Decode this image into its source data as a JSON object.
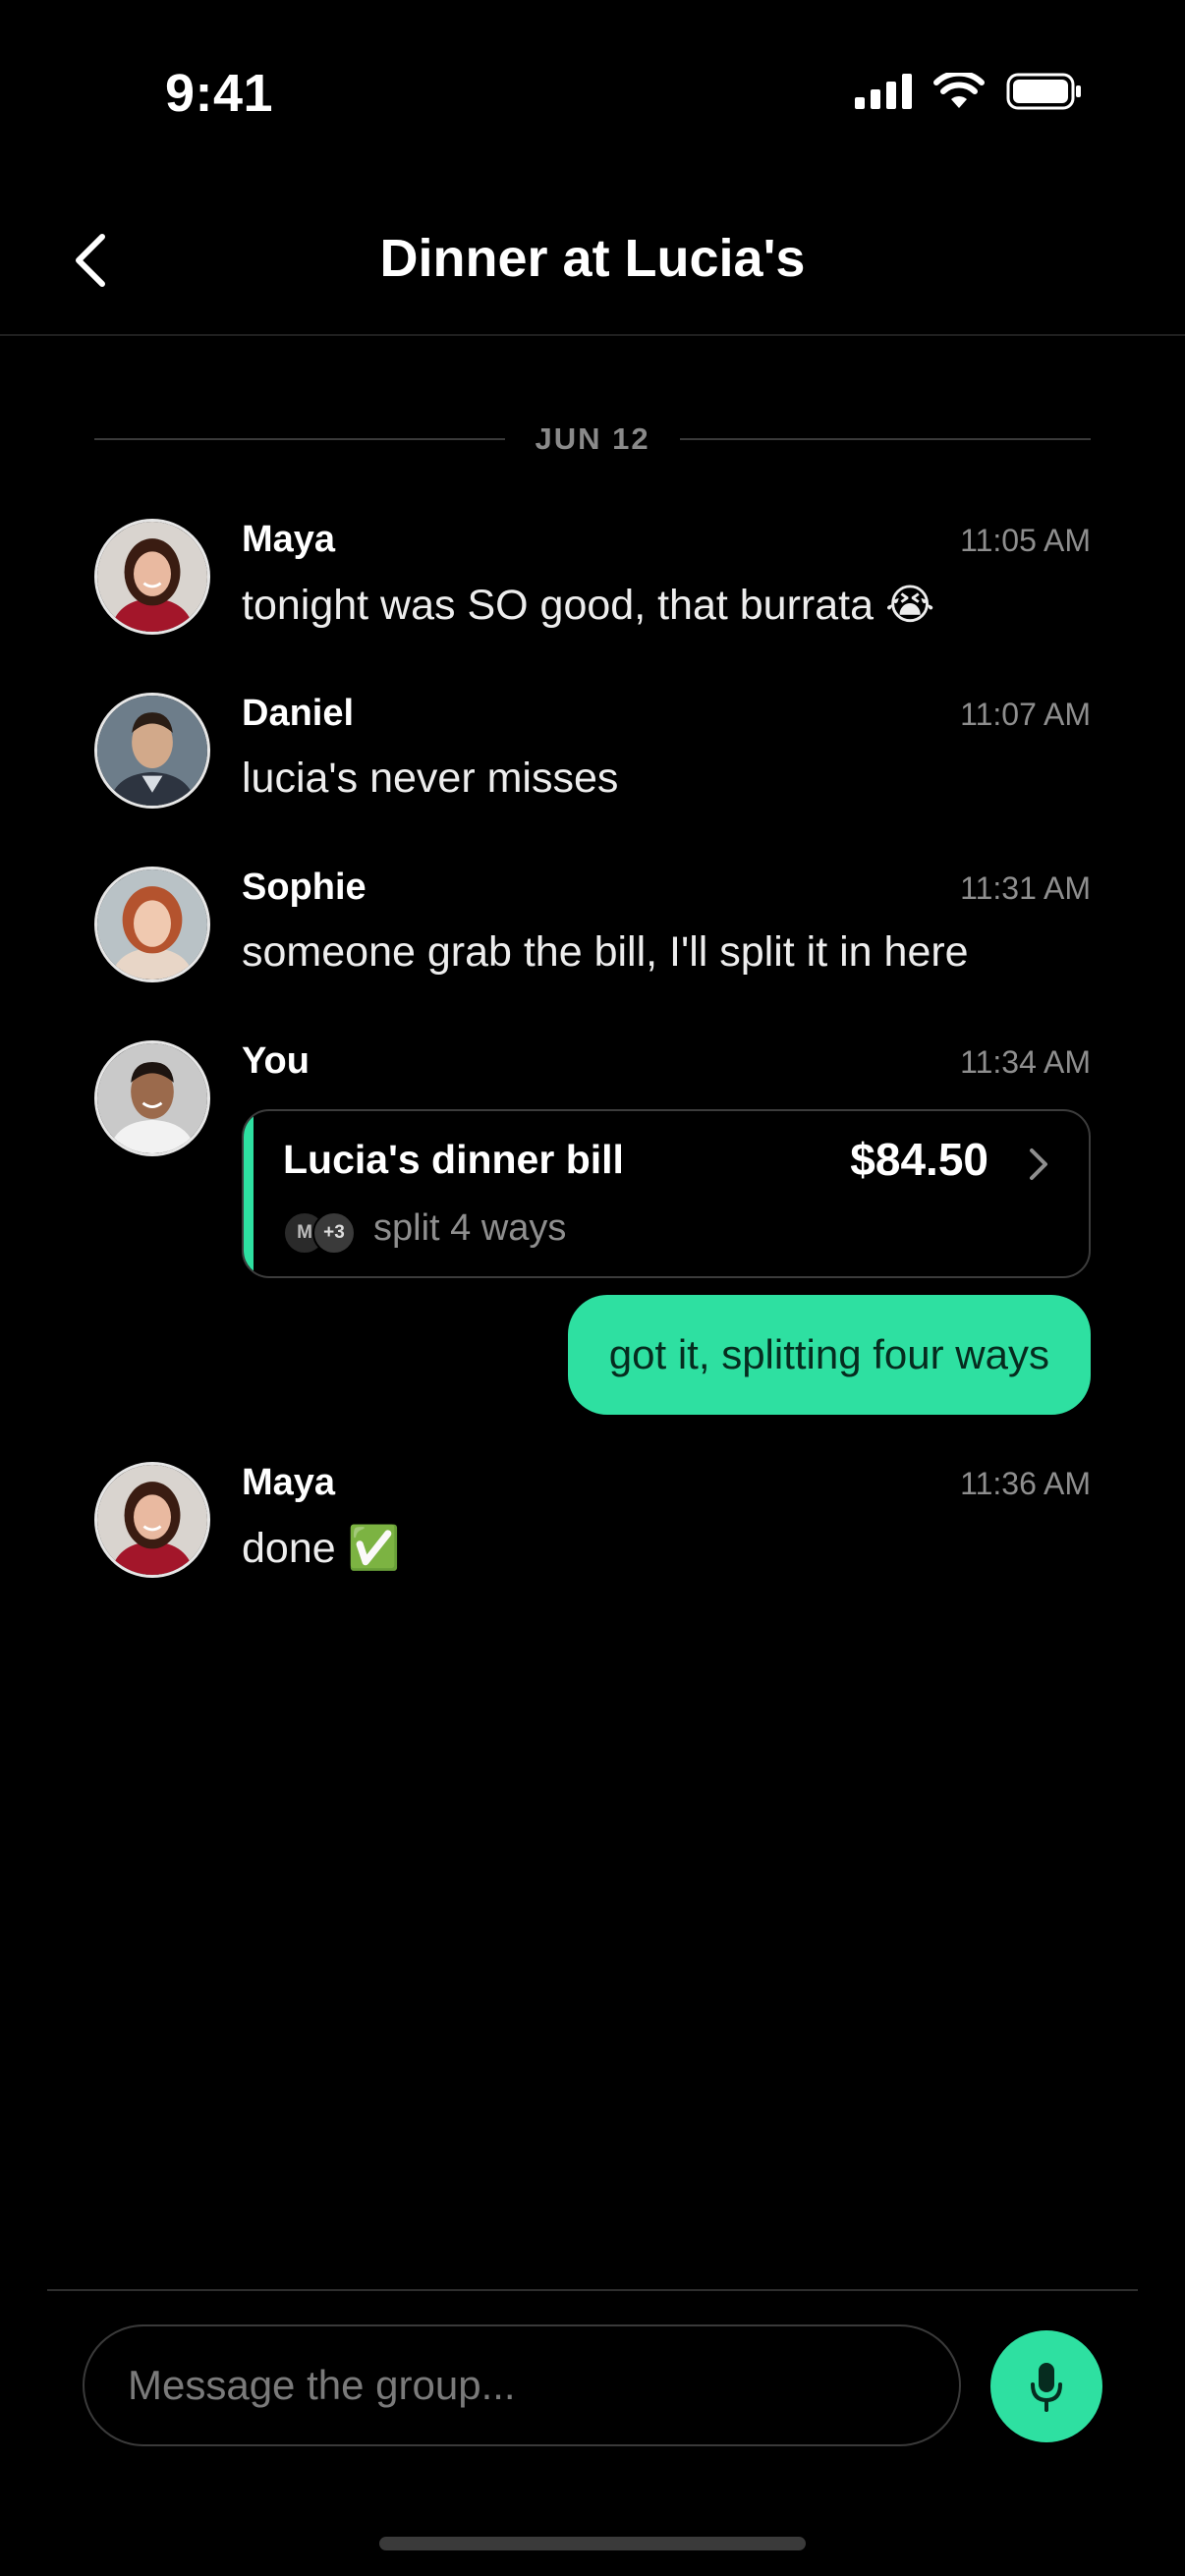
{
  "status_bar": {
    "time": "9:41",
    "icons": [
      "cellular-signal-icon",
      "wifi-icon",
      "battery-icon"
    ]
  },
  "header": {
    "back_icon": "chevron-left-icon",
    "title": "Dinner at Lucia's"
  },
  "date_separator": "JUN 12",
  "messages": [
    {
      "sender": "Maya",
      "time": "11:05 AM",
      "text": "tonight was SO good, that burrata 😭"
    },
    {
      "sender": "Daniel",
      "time": "11:07 AM",
      "text": "lucia's never misses"
    },
    {
      "sender": "Sophie",
      "time": "11:31 AM",
      "text": "someone grab the bill, I'll split it in here"
    },
    {
      "sender": "You",
      "time": "11:34 AM",
      "bill": {
        "title": "Lucia's dinner bill",
        "amount": "$84.50",
        "split_label": "split 4 ways",
        "avatar_initial": "M",
        "avatar_more": "+3"
      }
    },
    {
      "sender": "Maya",
      "time": "11:36 AM",
      "text": "done ✅"
    }
  ],
  "outgoing_message": "got it, splitting four ways",
  "composer": {
    "placeholder": "Message the group...",
    "value": "",
    "mic_icon": "microphone-icon"
  },
  "colors": {
    "accent": "#2ee0a1",
    "background": "#000000",
    "muted_text": "#8e8e8e"
  }
}
